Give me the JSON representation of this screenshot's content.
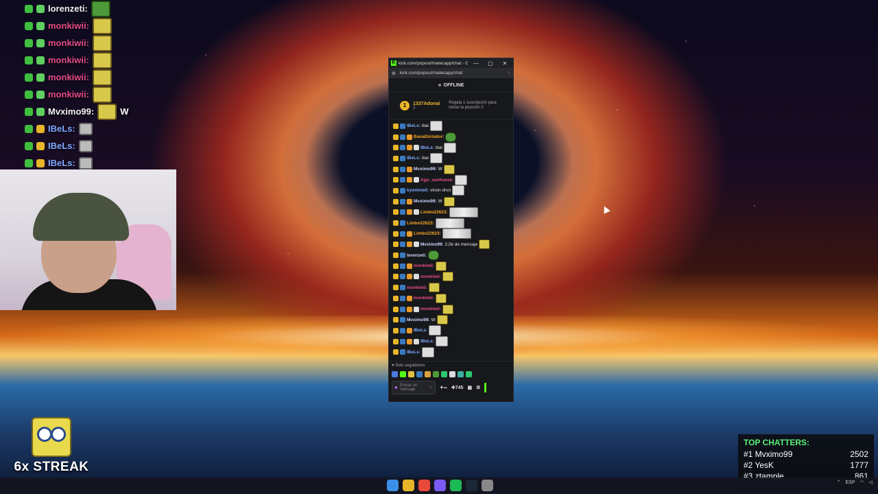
{
  "overlay_chat": [
    {
      "user": "lorenzeti:",
      "color": "#f2f2f2",
      "emote": "frog"
    },
    {
      "user": "monkiwii:",
      "color": "#e64b8a",
      "emote": "sponge"
    },
    {
      "user": "monkiwii:",
      "color": "#e64b8a",
      "emote": "sponge"
    },
    {
      "user": "monkiwii:",
      "color": "#e64b8a",
      "emote": "sponge"
    },
    {
      "user": "monkiwii:",
      "color": "#e64b8a",
      "emote": "sponge"
    },
    {
      "user": "monkiwii:",
      "color": "#e64b8a",
      "emote": "sponge"
    },
    {
      "user": "Mvximo99:",
      "color": "#f2f2f2",
      "emote": "sponge",
      "text": "W"
    },
    {
      "user": "IBeLs:",
      "color": "#7fa8ff",
      "emote": "small"
    },
    {
      "user": "IBeLs:",
      "color": "#7fa8ff",
      "emote": "small"
    },
    {
      "user": "IBeLs:",
      "color": "#7fa8ff",
      "emote": "small"
    }
  ],
  "streak": {
    "label": "6x STREAK"
  },
  "top_chatters": {
    "title": "TOP CHATTERS:",
    "rows": [
      {
        "rank": "#1",
        "name": "Mvximo99",
        "count": "2502"
      },
      {
        "rank": "#2",
        "name": "YesK",
        "count": "1777"
      },
      {
        "rank": "#3",
        "name": "ztample",
        "count": "861"
      }
    ]
  },
  "window": {
    "title": "kick.com/popout/matecapp/chat - G...",
    "url": "kick.com/popout/matecapp/chat",
    "status": "OFFLINE",
    "pinned": {
      "rank": "1",
      "user": "1337Adonai",
      "count": "2",
      "gift_line1": "Regala 1 suscripción para",
      "gift_line2": "tomar la posición 2"
    },
    "followers_only": "Solo seguidores",
    "input_placeholder": "Enviar un mensaje",
    "viewers": "745",
    "infinity": "∞",
    "accent": "#53fc18"
  },
  "chat_messages": [
    {
      "user": "IBeLs:",
      "color": "#7fa8ff",
      "text": "ibai",
      "emote": "img"
    },
    {
      "user": "BanaDictador:",
      "color": "#f5a623",
      "text": "",
      "emote": "frog"
    },
    {
      "user": "IBeLs:",
      "color": "#7fa8ff",
      "text": "ibai",
      "emote": "img"
    },
    {
      "user": "IBeLs:",
      "color": "#7fa8ff",
      "text": "ibai",
      "emote": "img"
    },
    {
      "user": "Mvximo99:",
      "color": "#cfd8ff",
      "text": "W",
      "emote": "sponge"
    },
    {
      "user": "Agu_sanhueza:",
      "color": "#e64b8a",
      "text": "",
      "emote": "img"
    },
    {
      "user": "kyommeli:",
      "color": "#7fa8ff",
      "text": "vinon drvo",
      "emote": "img"
    },
    {
      "user": "Mvximo99:",
      "color": "#cfd8ff",
      "text": "W",
      "emote": "sponge"
    },
    {
      "user": "Limbo22623:",
      "color": "#f5a623",
      "text": "",
      "emote": "wide"
    },
    {
      "user": "Limbo22623:",
      "color": "#f5a623",
      "text": "",
      "emote": "wide"
    },
    {
      "user": "Limbo22623:",
      "color": "#f5a623",
      "text": "",
      "emote": "wide"
    },
    {
      "user": "Mvximo99:",
      "color": "#cfd8ff",
      "text": "2,5k de mensaje",
      "emote": "sponge"
    },
    {
      "user": "lorenzeti:",
      "color": "#cfd8ff",
      "text": "",
      "emote": "frog"
    },
    {
      "user": "monkiwii:",
      "color": "#e64b8a",
      "text": "",
      "emote": "sponge"
    },
    {
      "user": "monkiwii:",
      "color": "#e64b8a",
      "text": "",
      "emote": "sponge"
    },
    {
      "user": "monkiwii:",
      "color": "#e64b8a",
      "text": "",
      "emote": "sponge"
    },
    {
      "user": "monkiwii:",
      "color": "#e64b8a",
      "text": "",
      "emote": "sponge"
    },
    {
      "user": "monkiwii:",
      "color": "#e64b8a",
      "text": "",
      "emote": "sponge"
    },
    {
      "user": "Mvximo99:",
      "color": "#cfd8ff",
      "text": "W",
      "emote": "sponge"
    },
    {
      "user": "IBeLs:",
      "color": "#7fa8ff",
      "text": "",
      "emote": "img"
    },
    {
      "user": "IBeLs:",
      "color": "#7fa8ff",
      "text": "",
      "emote": "img"
    },
    {
      "user": "IBeLs:",
      "color": "#7fa8ff",
      "text": "",
      "emote": "img"
    }
  ],
  "taskbar": {
    "icons": [
      "windows-icon",
      "folder-icon",
      "chrome-icon",
      "discord-icon",
      "spotify-icon",
      "steam-icon",
      "obs-icon"
    ],
    "lang": "ESP"
  }
}
